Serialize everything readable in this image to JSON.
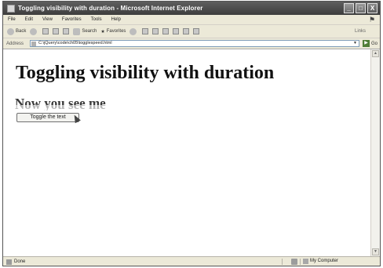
{
  "window": {
    "title": "Toggling visibility with duration - Microsoft Internet Explorer",
    "minimize": "_",
    "maximize": "□",
    "close": "X"
  },
  "menu": [
    "File",
    "Edit",
    "View",
    "Favorites",
    "Tools",
    "Help"
  ],
  "toolbar": {
    "back": "Back",
    "search": "Search",
    "favorites": "Favorites",
    "links": "Links"
  },
  "address": {
    "label": "Address",
    "value": "C:\\jQuery\\code\\ch05\\togglespeed.html",
    "go": "Go"
  },
  "page": {
    "heading": "Toggling visibility with duration",
    "text": "Now you see me",
    "button": "Toggle the text"
  },
  "status": {
    "left": "Done",
    "zone": "My Computer"
  }
}
